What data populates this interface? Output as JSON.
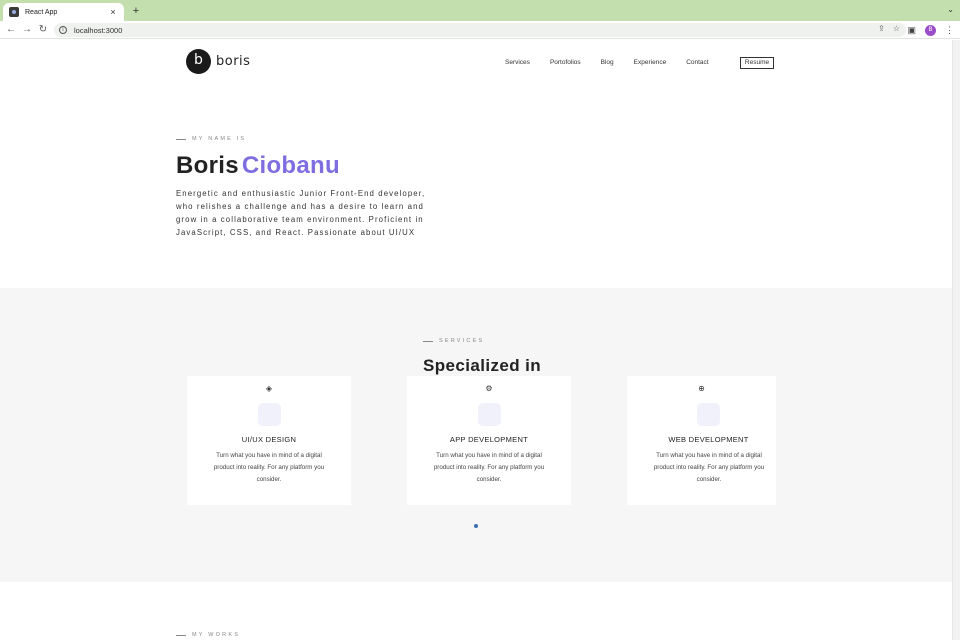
{
  "browser": {
    "tab_title": "React App",
    "close_glyph": "×",
    "new_tab_glyph": "+",
    "tabstrip_menu_glyph": "⌄",
    "back_glyph": "←",
    "forward_glyph": "→",
    "reload_glyph": "↻",
    "info_glyph": "i",
    "url": "localhost:3000",
    "share_glyph": "⇪",
    "bookmark_glyph": "☆",
    "sidepanel_glyph": "▣",
    "avatar_letter": "B",
    "menu_glyph": "⋮"
  },
  "header": {
    "logo_letter": "b",
    "logo_text": "boris",
    "nav": [
      "Services",
      "Portofolios",
      "Blog",
      "Experience",
      "Contact"
    ],
    "resume_label": "Resume"
  },
  "hero": {
    "eyebrow": "MY NAME IS",
    "first_name": "Boris",
    "last_name": "Ciobanu",
    "description": "Energetic and enthusiastic Junior Front-End developer, who relishes a challenge and has a desire to learn and grow in a collaborative team environment. Proficient in JavaScript, CSS, and React. Passionate about UI/UX"
  },
  "services": {
    "eyebrow": "SERVICES",
    "title": "Specialized in",
    "cards": [
      {
        "icon": "diamond-icon",
        "icon_glyph": "◈",
        "title": "UI/UX DESIGN",
        "text": "Turn what you have in mind of a digital product into reality. For any platform you consider."
      },
      {
        "icon": "gear-icon",
        "icon_glyph": "⚙",
        "title": "APP DEVELOPMENT",
        "text": "Turn what you have in mind of a digital product into reality. For any platform you consider."
      },
      {
        "icon": "globe-icon",
        "icon_glyph": "⊕",
        "title": "WEB DEVELOPMENT",
        "text": "Turn what you have in mind of a digital product into reality. For any platform you consider."
      }
    ]
  },
  "works": {
    "eyebrow": "MY WORKS"
  },
  "colors": {
    "accent": "#7e6ee0",
    "tabbar": "#c3dfae",
    "avatar": "#9b4dca",
    "pagination_dot": "#3a6fb0"
  }
}
